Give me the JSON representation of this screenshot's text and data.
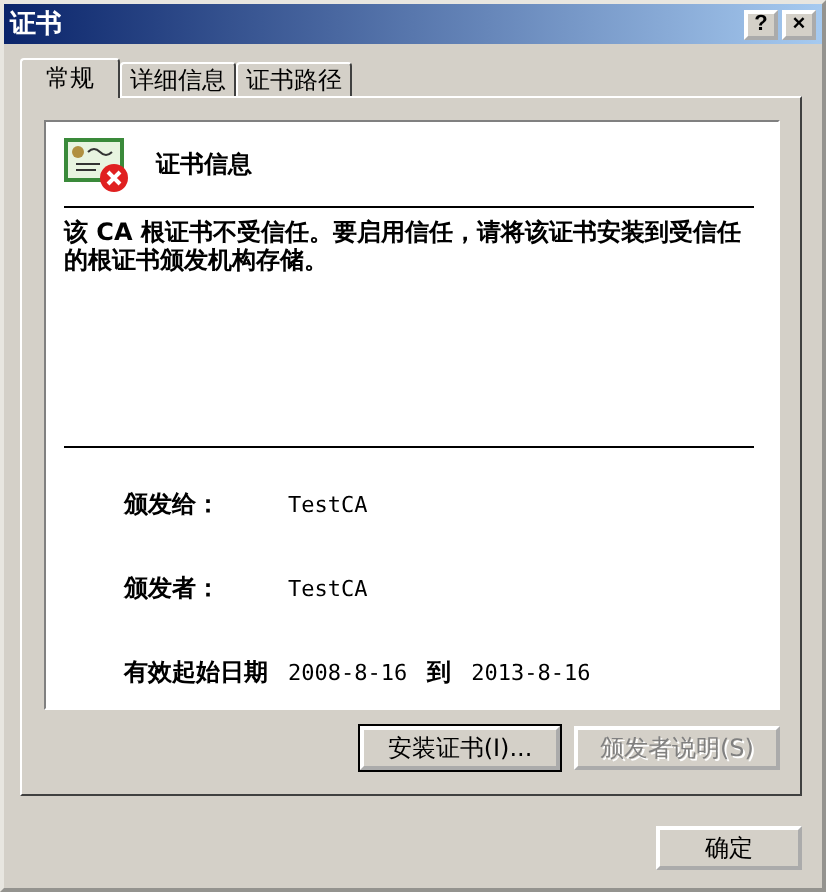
{
  "window": {
    "title": "证书",
    "help_button": "?",
    "close_button": "×"
  },
  "tabs": [
    {
      "label": "常规",
      "selected": true
    },
    {
      "label": "详细信息",
      "selected": false
    },
    {
      "label": "证书路径",
      "selected": false
    }
  ],
  "info": {
    "heading": "证书信息",
    "message": "该 CA 根证书不受信任。要启用信任，请将该证书安装到受信任的根证书颁发机构存储。",
    "issued_to_label": "颁发给：",
    "issued_to": "TestCA",
    "issued_by_label": "颁发者：",
    "issued_by": "TestCA",
    "valid_label": "有效起始日期",
    "valid_from": "2008-8-16",
    "to_label": "到",
    "valid_to": "2013-8-16"
  },
  "buttons": [
    {
      "label": "安装证书(I)...",
      "disabled": false,
      "focused": true
    },
    {
      "label": "颁发者说明(S)",
      "disabled": true,
      "focused": false
    }
  ],
  "ok_button": {
    "label": "确定"
  }
}
